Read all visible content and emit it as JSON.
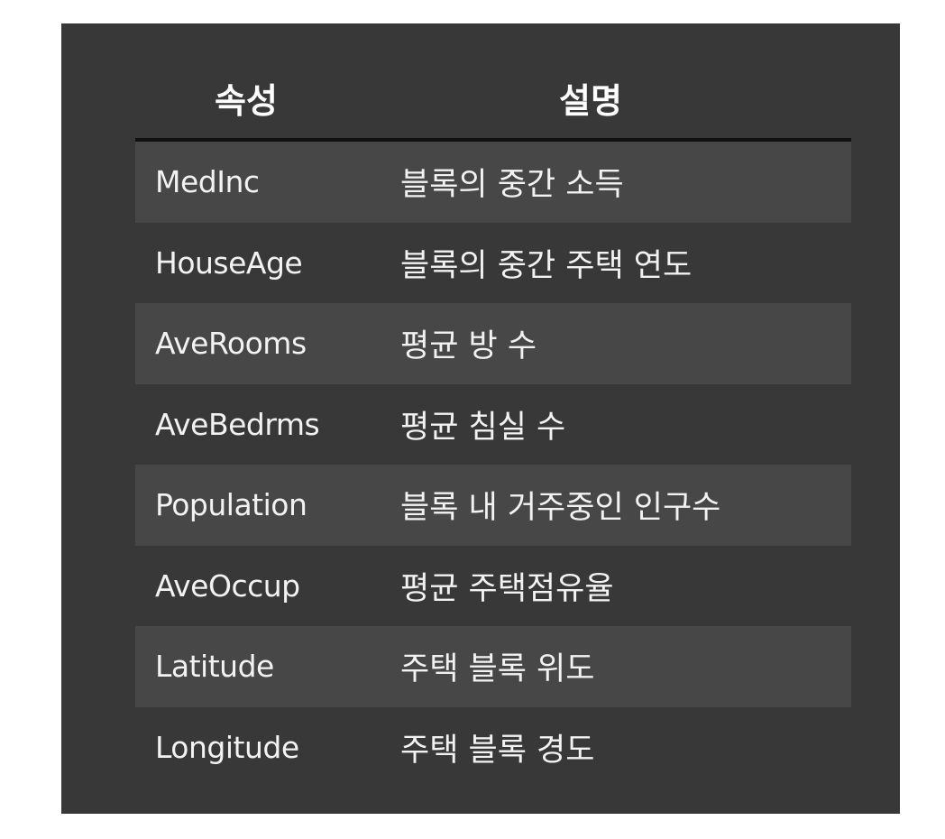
{
  "table": {
    "headers": {
      "attribute": "속성",
      "description": "설명"
    },
    "rows": [
      {
        "attribute": "MedInc",
        "description": "블록의 중간 소득"
      },
      {
        "attribute": "HouseAge",
        "description": "블록의 중간 주택 연도"
      },
      {
        "attribute": "AveRooms",
        "description": "평균 방 수"
      },
      {
        "attribute": "AveBedrms",
        "description": "평균 침실 수"
      },
      {
        "attribute": "Population",
        "description": "블록 내 거주중인 인구수"
      },
      {
        "attribute": "AveOccup",
        "description": "평균 주택점유율"
      },
      {
        "attribute": "Latitude",
        "description": "주택 블록 위도"
      },
      {
        "attribute": "Longitude",
        "description": "주택 블록 경도"
      }
    ]
  },
  "colors": {
    "panel_background": "#383838",
    "shaded_row": "#474747",
    "header_rule": "#111111",
    "text": "#f2f2f2"
  }
}
